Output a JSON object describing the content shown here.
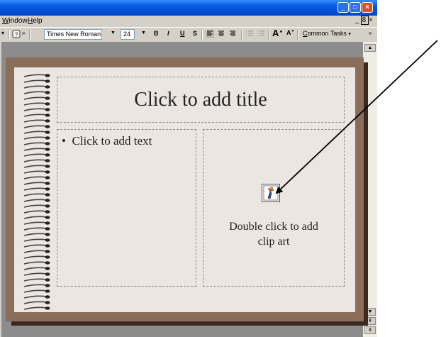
{
  "menubar": {
    "items": [
      {
        "label": "Window",
        "accel": "W",
        "rest": "indow"
      },
      {
        "label": "Help",
        "accel": "H",
        "rest": "elp"
      }
    ]
  },
  "toolbar": {
    "font_name": "Times New Roman",
    "font_size": "24",
    "bold": "B",
    "italic": "I",
    "underline": "U",
    "shadow": "S",
    "increase_font": "A",
    "decrease_font": "A",
    "common_tasks": "Common Tasks",
    "common_tasks_accel": "C",
    "common_tasks_rest": "ommon Tasks"
  },
  "slide": {
    "title_placeholder": "Click to add title",
    "body_placeholder": "Click to add text",
    "bullet": "•",
    "clipart_line1": "Double click to add",
    "clipart_line2": "clip art"
  },
  "icons": {
    "minimize": "minimize-icon",
    "maximize": "maximize-icon",
    "close": "close-icon",
    "help": "help-icon",
    "clipart": "clipart-icon",
    "arrow": "annotation-arrow"
  },
  "colors": {
    "titlebar": "#0a5fe0",
    "slide_frame": "#8a6e5a",
    "slide_bg": "#ece6e3",
    "close": "#d8502c"
  }
}
